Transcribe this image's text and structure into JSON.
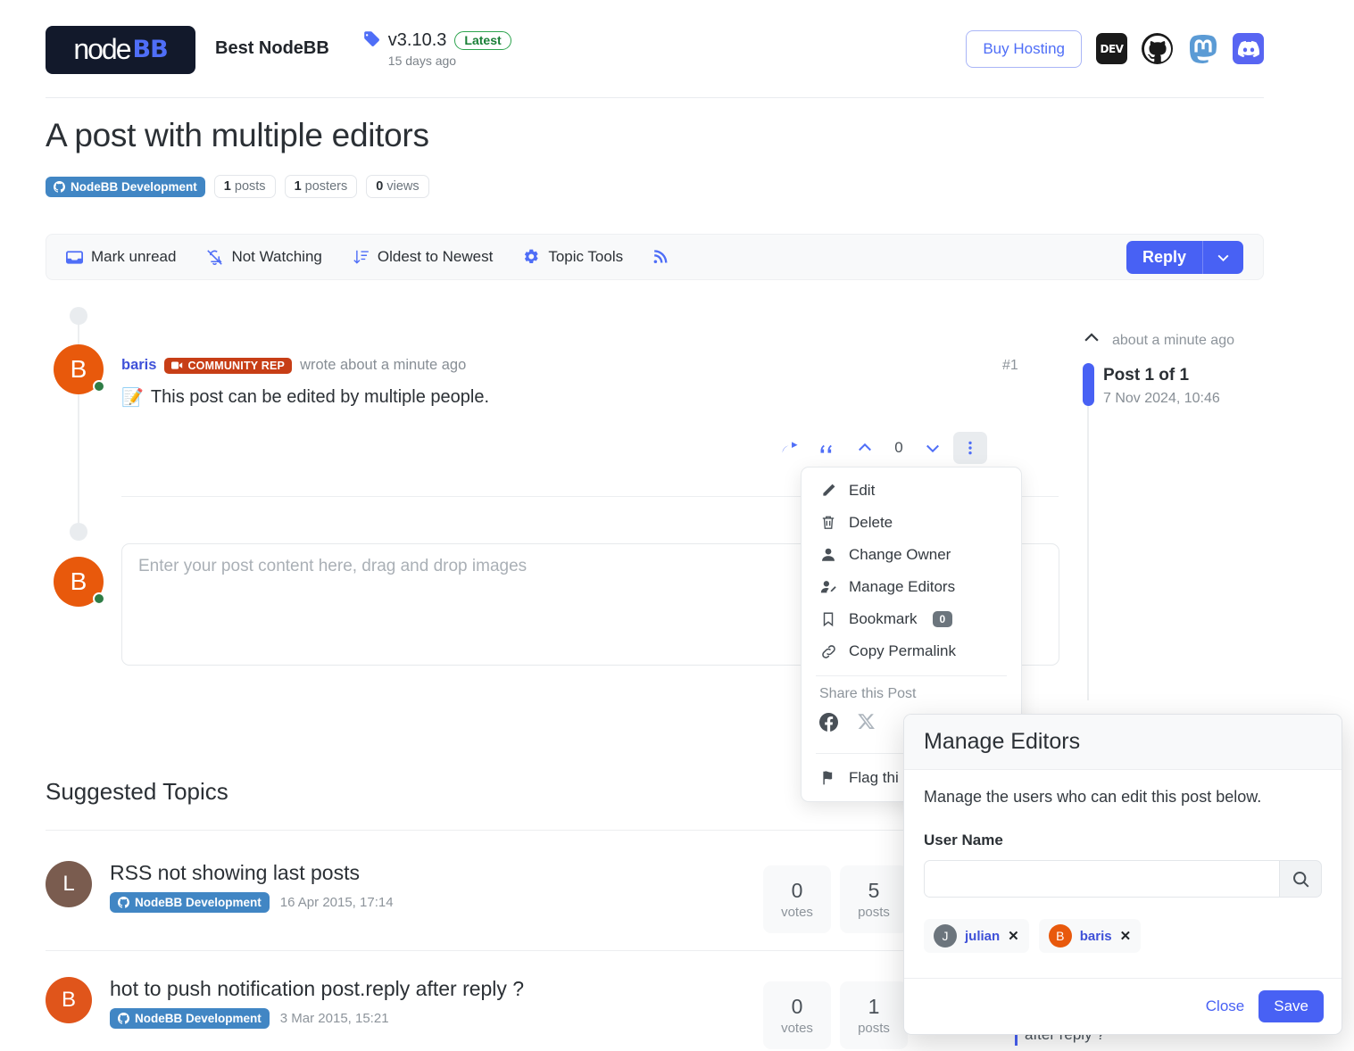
{
  "header": {
    "logo_node": "node",
    "logo_bb": "BB",
    "site_title": "Best NodeBB",
    "version": "v3.10.3",
    "latest_label": "Latest",
    "version_ago": "15 days ago",
    "buy_hosting": "Buy Hosting",
    "icons": [
      {
        "name": "dev-icon",
        "label": "DEV"
      },
      {
        "name": "github-icon",
        "label": ""
      },
      {
        "name": "mastodon-icon",
        "label": ""
      },
      {
        "name": "discord-icon",
        "label": ""
      }
    ]
  },
  "topic": {
    "title": "A post with multiple editors",
    "category": "NodeBB Development",
    "posts_count": "1",
    "posts_label": "posts",
    "posters_count": "1",
    "posters_label": "posters",
    "views_count": "0",
    "views_label": "views"
  },
  "toolbar": {
    "mark_unread": "Mark unread",
    "not_watching": "Not Watching",
    "sort": "Oldest to Newest",
    "topic_tools": "Topic Tools",
    "rss": "rss-icon",
    "reply": "Reply"
  },
  "post": {
    "author": "baris",
    "badge": "COMMUNITY REP",
    "wrote": "wrote about a minute ago",
    "index": "#1",
    "content": "This post can be edited by multiple people.",
    "avatar_letter": "B",
    "vote_count": "0"
  },
  "composer": {
    "placeholder": "Enter your post content here, drag and drop images",
    "avatar_letter": "B"
  },
  "menu": {
    "items": [
      {
        "icon": "pencil-icon",
        "label": "Edit"
      },
      {
        "icon": "trash-icon",
        "label": "Delete"
      },
      {
        "icon": "user-icon",
        "label": "Change Owner"
      },
      {
        "icon": "user-edit-icon",
        "label": "Manage Editors"
      },
      {
        "icon": "bookmark-icon",
        "label": "Bookmark",
        "badge": "0"
      },
      {
        "icon": "link-icon",
        "label": "Copy Permalink"
      }
    ],
    "share_label": "Share this Post",
    "share_icons": [
      {
        "name": "facebook-icon"
      },
      {
        "name": "x-twitter-icon"
      }
    ],
    "flag_label": "Flag thi"
  },
  "right_timeline": {
    "ago": "about a minute ago",
    "post_position": "Post 1 of 1",
    "post_date": "7 Nov 2024, 10:46"
  },
  "modal": {
    "title": "Manage Editors",
    "description": "Manage the users who can edit this post below.",
    "field_label": "User Name",
    "search_value": "",
    "search_placeholder": "",
    "editors": [
      {
        "name": "julian",
        "letter": "J",
        "color": "#6c757d"
      },
      {
        "name": "baris",
        "letter": "B",
        "color": "#e8590c"
      }
    ],
    "close_label": "Close",
    "save_label": "Save"
  },
  "suggested": {
    "heading": "Suggested Topics",
    "topics": [
      {
        "title": "RSS not showing last posts",
        "category": "NodeBB Development",
        "date": "16 Apr 2015, 17:14",
        "avatar_letter": "L",
        "avatar_color": "#7a5c4f",
        "votes": "0",
        "votes_label": "votes",
        "posts": "5",
        "posts_label": "posts"
      },
      {
        "title": "hot to push notification post.reply after reply ?",
        "category": "NodeBB Development",
        "date": "3 Mar 2015, 15:21",
        "avatar_letter": "B",
        "avatar_color": "#e0551b",
        "votes": "0",
        "votes_label": "votes",
        "posts": "1",
        "posts_label": "posts"
      }
    ],
    "teaser": "after reply ?"
  },
  "colors": {
    "accent": "#4861f4",
    "category_badge": "#4186c4",
    "avatar_orange": "#e8590c",
    "rep_badge": "#c73e16",
    "online": "#2f7d46"
  }
}
